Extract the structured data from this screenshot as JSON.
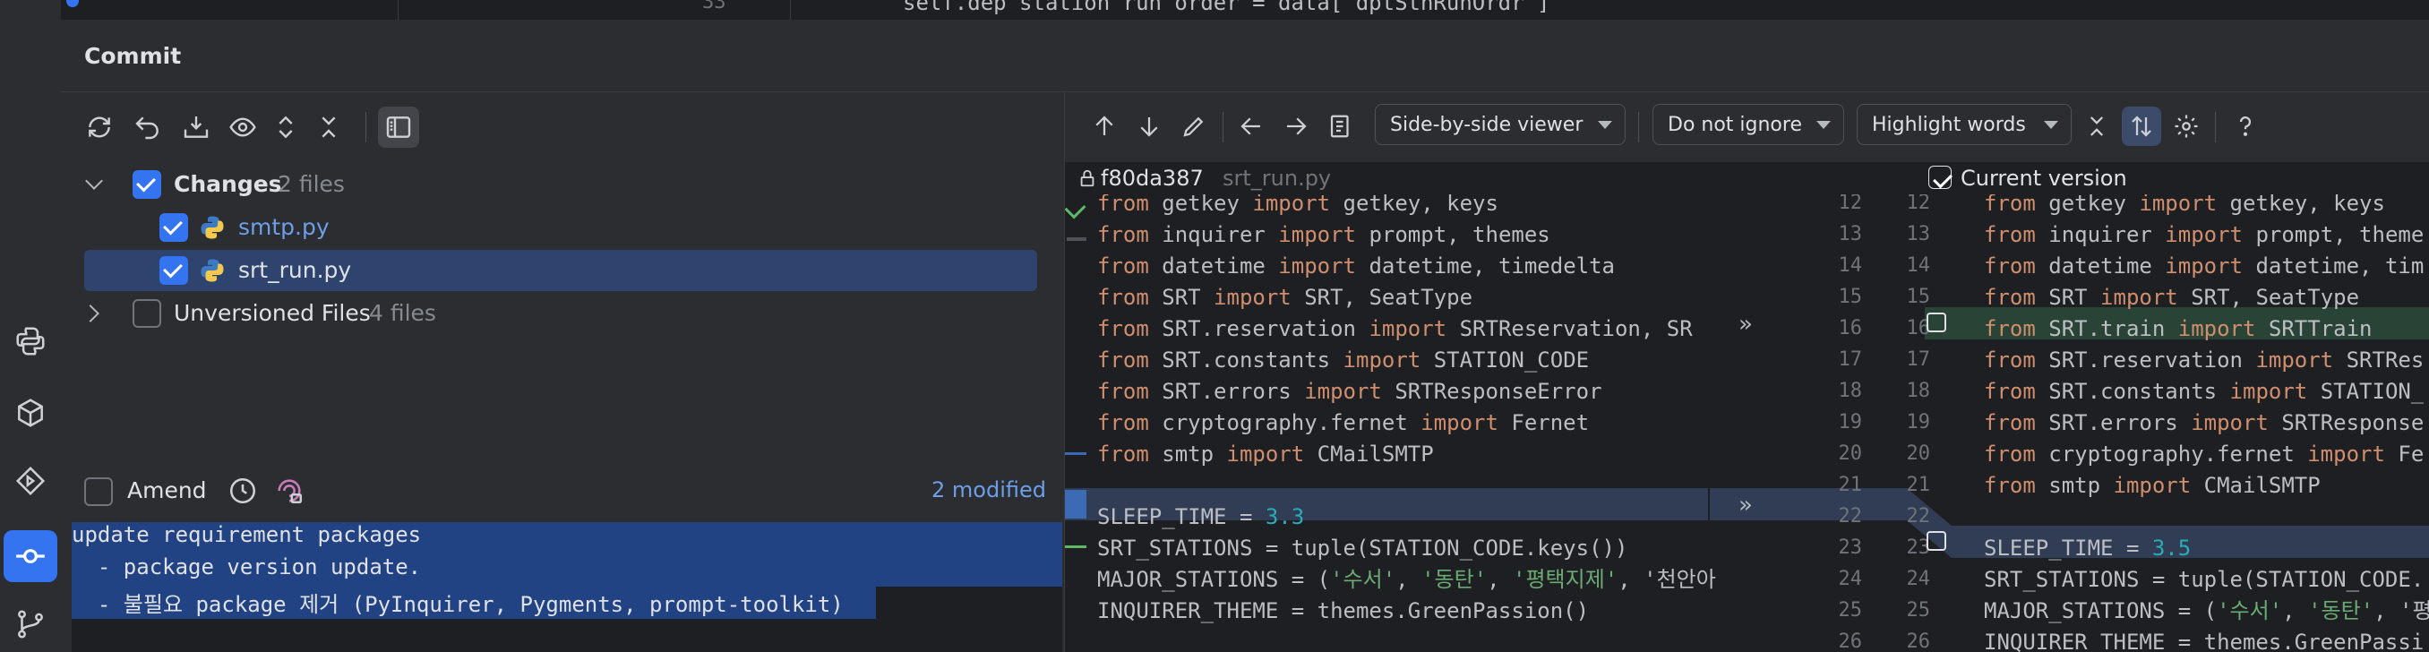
{
  "top_code": {
    "line_number": "33",
    "text": "self.dep station run order = data[\"dptStnRunOrdr\"]"
  },
  "commit": {
    "title": "Commit"
  },
  "tree": {
    "changes_label": "Changes",
    "changes_count": "2 files",
    "files": [
      {
        "name": "smtp.py",
        "checked": true
      },
      {
        "name": "srt_run.py",
        "checked": true
      }
    ],
    "unversioned_label": "Unversioned Files",
    "unversioned_count": "4 files"
  },
  "amend": {
    "label": "Amend",
    "modified": "2 modified"
  },
  "message": {
    "lines": [
      "update requirement packages",
      "  - package version update.",
      "  - 불필요 package 제거 (PyInquirer, Pygments, prompt-toolkit)"
    ]
  },
  "diff_toolbar": {
    "viewer": "Side-by-side viewer",
    "ignore": "Do not ignore",
    "highlight": "Highlight words"
  },
  "diff_header": {
    "left_rev": "f80da387",
    "left_file": "srt_run.py",
    "right_label": "Current version"
  },
  "left_code": [
    {
      "n": "12",
      "t": "from getkey import getkey, keys"
    },
    {
      "n": "13",
      "t": "from inquirer import prompt, themes"
    },
    {
      "n": "14",
      "t": "from datetime import datetime, timedelta"
    },
    {
      "n": "15",
      "t": "from SRT import SRT, SeatType"
    },
    {
      "n": "16",
      "t": "from SRT.reservation import SRTReservation, SR"
    },
    {
      "n": "17",
      "t": "from SRT.constants import STATION_CODE"
    },
    {
      "n": "18",
      "t": "from SRT.errors import SRTResponseError"
    },
    {
      "n": "19",
      "t": "from cryptography.fernet import Fernet"
    },
    {
      "n": "20",
      "t": "from smtp import CMailSMTP"
    },
    {
      "n": "21",
      "t": ""
    },
    {
      "n": "22",
      "t": "SLEEP_TIME = 3.3"
    },
    {
      "n": "23",
      "t": "SRT_STATIONS = tuple(STATION_CODE.keys())"
    },
    {
      "n": "24",
      "t": "MAJOR_STATIONS = ('수서', '동탄', '평택지제', '천안아"
    },
    {
      "n": "25",
      "t": "INQUIRER_THEME = themes.GreenPassion()"
    },
    {
      "n": "26",
      "t": ""
    }
  ],
  "right_code": [
    {
      "n": "12",
      "t": "from getkey import getkey, keys"
    },
    {
      "n": "13",
      "t": "from inquirer import prompt, theme"
    },
    {
      "n": "14",
      "t": "from datetime import datetime, tim"
    },
    {
      "n": "15",
      "t": "from SRT import SRT, SeatType"
    },
    {
      "n": "16",
      "t": "from SRT.train import SRTTrain"
    },
    {
      "n": "17",
      "t": "from SRT.reservation import SRTRes"
    },
    {
      "n": "18",
      "t": "from SRT.constants import STATION_"
    },
    {
      "n": "19",
      "t": "from SRT.errors import SRTResponse"
    },
    {
      "n": "20",
      "t": "from cryptography.fernet import Fe"
    },
    {
      "n": "21",
      "t": "from smtp import CMailSMTP"
    },
    {
      "n": "22",
      "t": ""
    },
    {
      "n": "23",
      "t": "SLEEP_TIME = 3.5"
    },
    {
      "n": "24",
      "t": "SRT_STATIONS = tuple(STATION_CODE."
    },
    {
      "n": "25",
      "t": "MAJOR_STATIONS = ('수서', '동탄', '평"
    },
    {
      "n": "26",
      "t": "INQUIRER_THEME = themes.GreenPassi"
    }
  ],
  "colors": {
    "accent": "#3574f0",
    "selection": "#2e436e",
    "message_selection": "#214283",
    "added_bg": "#294436",
    "modified_bg": "#303d55"
  }
}
